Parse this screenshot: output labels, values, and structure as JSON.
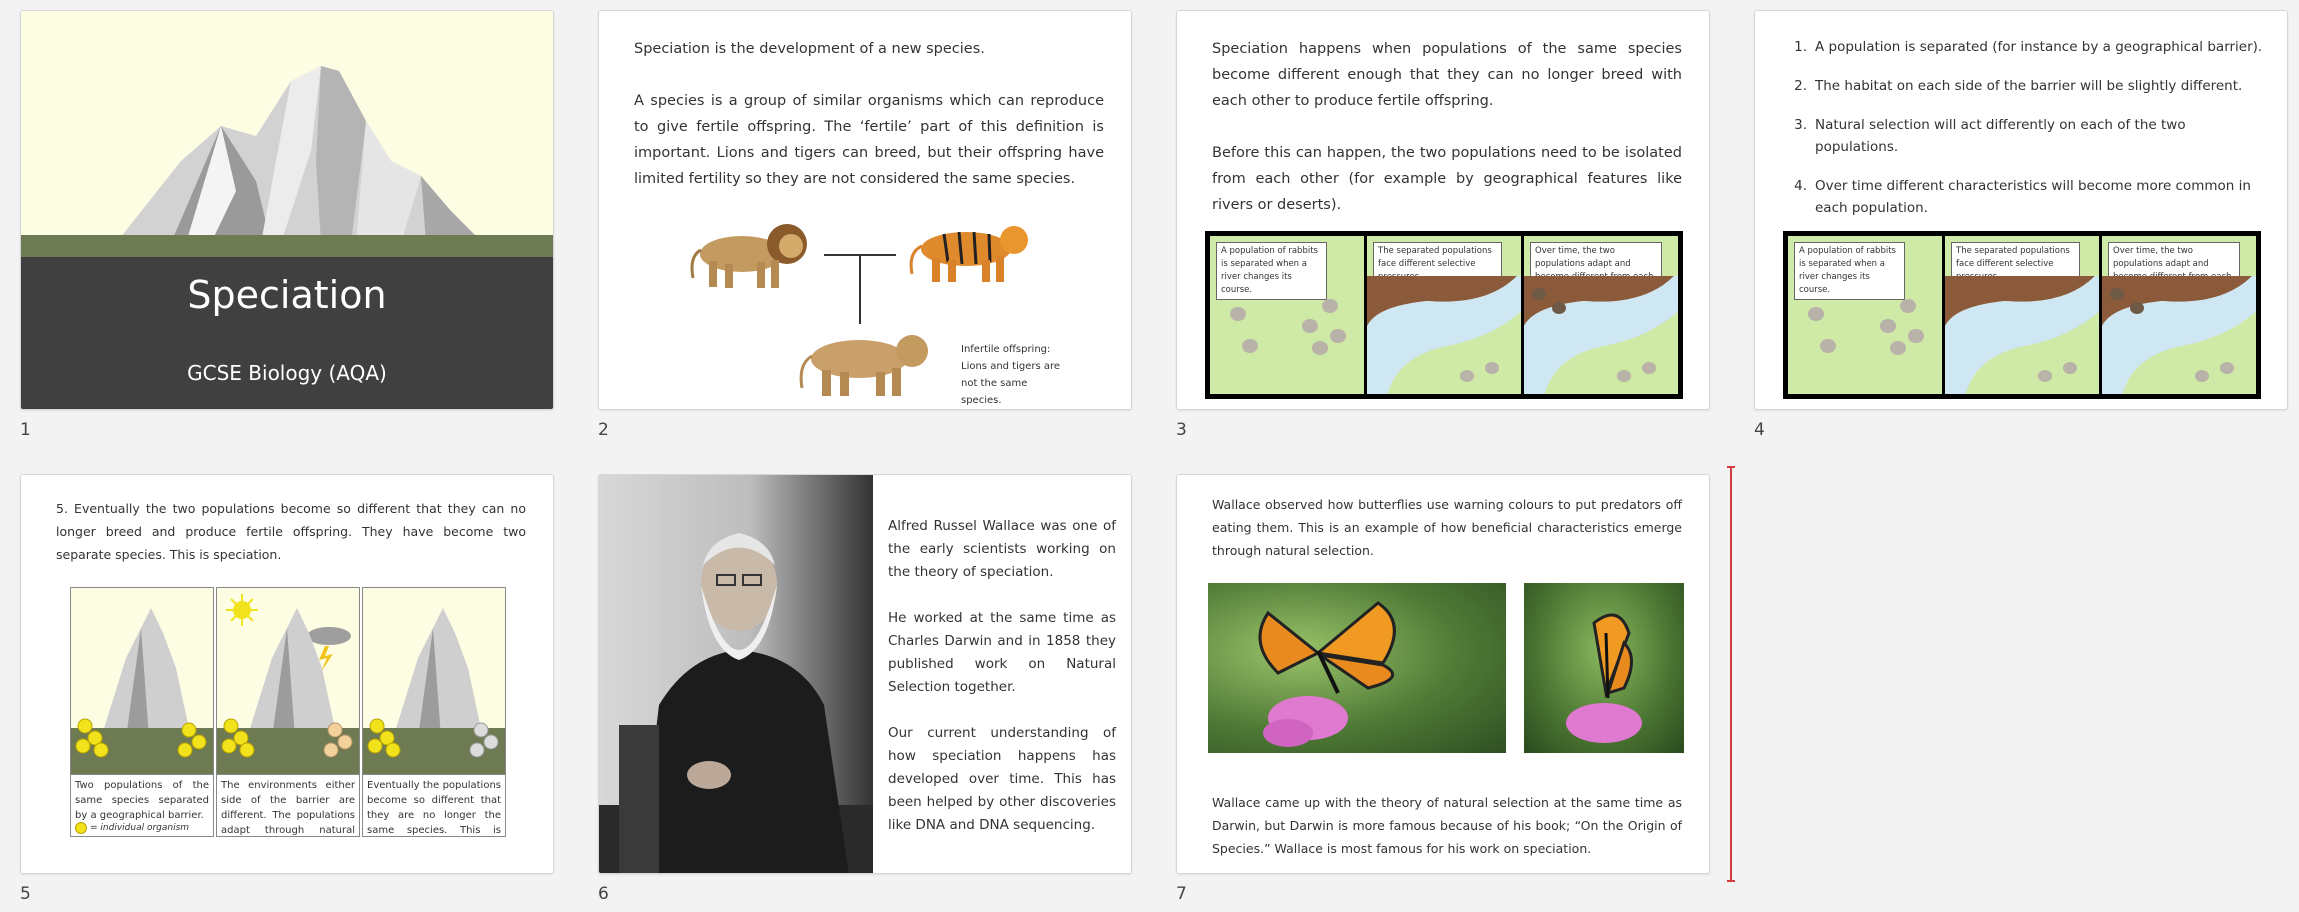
{
  "slides": [
    {
      "number": "1",
      "title": "Speciation",
      "subtitle": "GCSE Biology (AQA)"
    },
    {
      "number": "2",
      "paragraphs": [
        "Speciation is the development of a new species.",
        "A species is a group of similar organisms which can reproduce to give fertile offspring. The ‘fertile’ part of this definition is important. Lions and tigers can breed, but their offspring have limited fertility so they are not considered the same species."
      ],
      "offspring_caption": [
        "Infertile offspring:",
        "Lions and tigers are",
        "not the same species."
      ]
    },
    {
      "number": "3",
      "paragraphs": [
        "Speciation happens when populations of the same species become different enough that they can no longer breed with each other to produce fertile offspring.",
        "Before this can happen, the two populations need to be isolated from each other (for example by geographical features like rivers or deserts)."
      ]
    },
    {
      "number": "4",
      "list": [
        {
          "n": "1.",
          "text": "A population is separated (for instance by a geographical barrier)."
        },
        {
          "n": "2.",
          "text": "The habitat on each side of the barrier will be slightly different."
        },
        {
          "n": "3.",
          "text": "Natural selection will act differently on each of the two populations."
        },
        {
          "n": "4.",
          "text": "Over time different characteristics will become more common in each population."
        }
      ]
    },
    {
      "number": "5",
      "text": "5. Eventually the two populations become so different that they can no longer breed and produce fertile offspring. They have become two separate species. This is speciation.",
      "captions": [
        "Two populations of the same species separated by a geographical barrier.",
        "The environments either side of the barrier are different. The populations adapt through natural selection.",
        "Eventually the populations become so different that they are no longer the same species. This is called speciation."
      ],
      "legend": "= individual organism"
    },
    {
      "number": "6",
      "paragraphs": [
        "Alfred Russel Wallace was one of the early scientists working on the theory of speciation.",
        "He worked at the same time as Charles Darwin and in 1858 they published work on Natural Selection together.",
        "Our current understanding of how speciation happens has developed over time. This has been helped by other discoveries like DNA and DNA sequencing."
      ]
    },
    {
      "number": "7",
      "top": "Wallace observed how butterflies use warning colours to put predators off eating them. This is an example of how beneficial characteristics emerge through natural selection.",
      "bottom": "Wallace came up with the theory of natural selection at the same time as Darwin, but Darwin is more famous because of his book; “On the Origin of Species.” Wallace is most famous for his work on speciation."
    }
  ],
  "comic_captions": [
    "A population of rabbits is separated when a river changes its course.",
    "The separated populations face different selective pressures.",
    "Over time, the two populations adapt and become different from each other."
  ],
  "colors": {
    "title_bg": "#404040",
    "sky": "#fdfde3",
    "ground": "#6e7b52",
    "insert_marker": "#d23b3b"
  }
}
